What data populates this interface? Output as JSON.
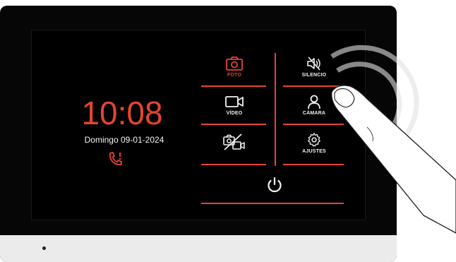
{
  "clock": {
    "time": "10:08",
    "date": "Domingo  09-01-2024"
  },
  "menu": {
    "foto": "FOTO",
    "silencio": "SILENCIO",
    "video": "VÍDEO",
    "camara": "CÁMARA",
    "ajustes": "AJUSTES"
  },
  "icons": {
    "foto": "camera-icon",
    "silencio": "speaker-mute-icon",
    "video": "video-camera-icon",
    "camara": "user-icon",
    "camera_off": "camera-off-icon",
    "ajustes": "gear-icon",
    "power": "power-icon",
    "missed_call": "missed-call-icon"
  },
  "colors": {
    "accent": "#e6452f",
    "text": "#f2f2f2",
    "background": "#000000"
  }
}
